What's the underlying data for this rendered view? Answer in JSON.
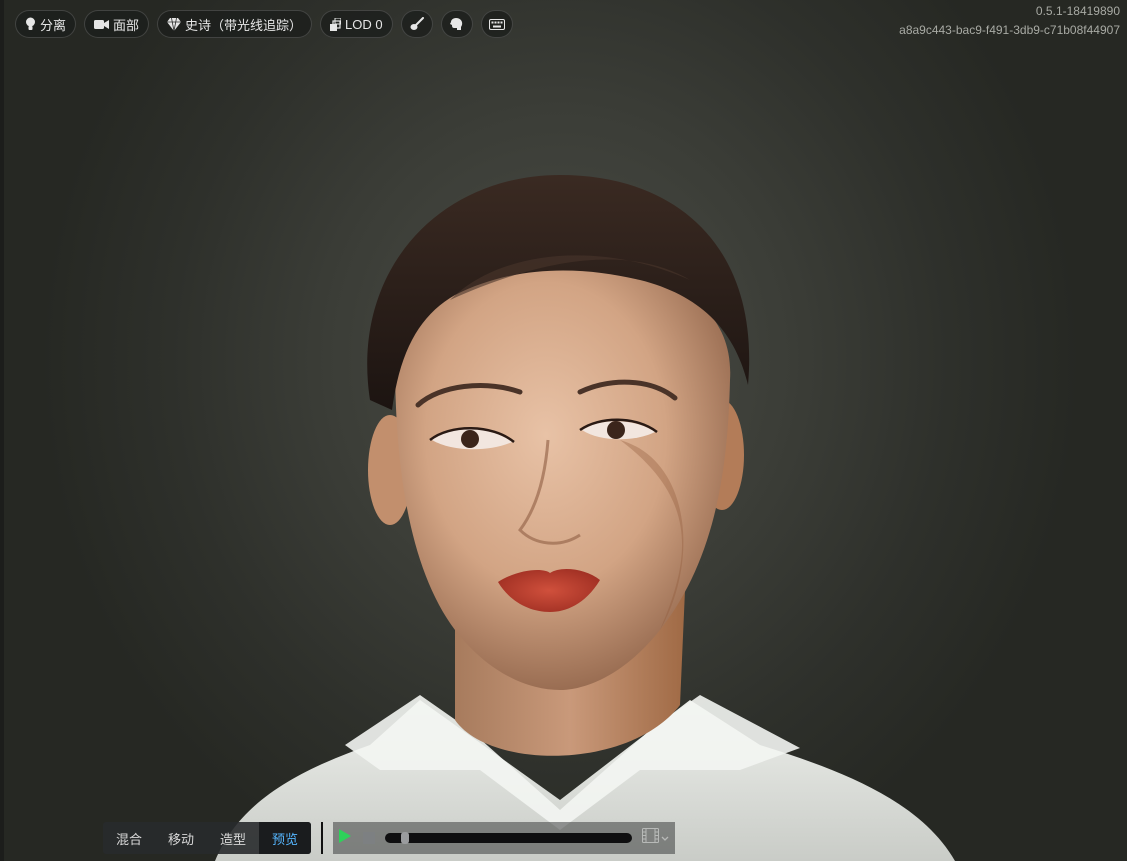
{
  "toolbar": {
    "buttons": [
      {
        "label": "分离",
        "icon": "light-bulb-icon"
      },
      {
        "label": "面部",
        "icon": "camera-icon"
      },
      {
        "label": "史诗（带光线追踪）",
        "icon": "diamond-icon"
      },
      {
        "label": "LOD 0",
        "icon": "layers-icon"
      },
      {
        "label": "",
        "icon": "brush-icon"
      },
      {
        "label": "",
        "icon": "head-icon"
      },
      {
        "label": "",
        "icon": "keyboard-icon"
      }
    ]
  },
  "meta": {
    "version": "0.5.1-18419890",
    "id": "a8a9c443-bac9-f491-3db9-c71b08f44907"
  },
  "bottom_bar": {
    "modes": [
      "混合",
      "移动",
      "造型",
      "预览"
    ],
    "active_mode": "预览",
    "playback_progress": 0.08,
    "icons": [
      "play-icon",
      "stop-icon",
      "film-icon",
      "chevron-down-icon"
    ]
  },
  "colors": {
    "active_tab_text": "#55b6ff",
    "play_green": "#2fd15a"
  }
}
